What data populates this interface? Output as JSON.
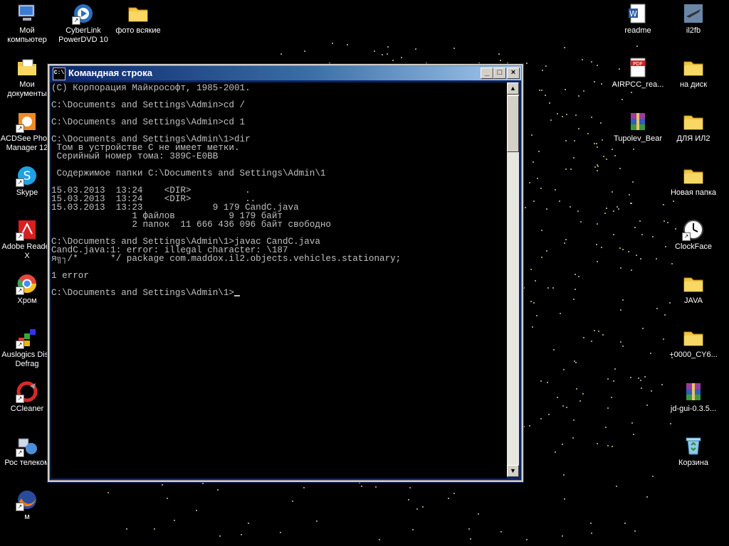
{
  "desktop": {
    "left_icons": [
      {
        "label": "Мой\nкомпьютер",
        "icon": "my-computer-icon"
      },
      {
        "label": "Мои\nдокументы",
        "icon": "my-documents-icon"
      },
      {
        "label": "ACDSee Photo\nManager 12",
        "icon": "acdsee-icon"
      },
      {
        "label": "Skype",
        "icon": "skype-icon"
      },
      {
        "label": "Adobe Reader\nX",
        "icon": "adobe-reader-icon"
      },
      {
        "label": "Хром",
        "icon": "chrome-icon"
      },
      {
        "label": "Auslogics Disk\nDefrag",
        "icon": "auslogics-icon"
      },
      {
        "label": "CCleaner",
        "icon": "ccleaner-icon"
      },
      {
        "label": "Рос телеком",
        "icon": "network-icon"
      },
      {
        "label": "м",
        "icon": "firefox-icon"
      }
    ],
    "top_icons": [
      {
        "label": "CyberLink\nPowerDVD 10",
        "icon": "powerdvd-icon"
      },
      {
        "label": "фото всякие",
        "icon": "folder-icon"
      }
    ],
    "right_col1": [
      {
        "label": "readme",
        "icon": "word-doc-icon"
      },
      {
        "label": "AIRPCC_rea...",
        "icon": "pdf-icon"
      },
      {
        "label": "Tupolev_Bear",
        "icon": "winrar-icon"
      }
    ],
    "right_col2": [
      {
        "label": "il2fb",
        "icon": "il2fb-icon"
      },
      {
        "label": "на диск",
        "icon": "folder-icon"
      },
      {
        "label": "ДЛЯ ИЛ2",
        "icon": "folder-icon"
      },
      {
        "label": "Новая папка",
        "icon": "folder-icon"
      },
      {
        "label": "ClockFace",
        "icon": "clock-icon"
      },
      {
        "label": "JAVA",
        "icon": "folder-icon"
      },
      {
        "label": "+0000_CY6...",
        "icon": "folder-icon"
      },
      {
        "label": "jd-gui-0.3.5...",
        "icon": "winrar-icon"
      },
      {
        "label": "Корзина",
        "icon": "recycle-bin-icon"
      }
    ]
  },
  "window": {
    "title": "Командная строка",
    "sys_icon_text": "C:\\",
    "minimize": "_",
    "maximize": "□",
    "close": "×"
  },
  "console": {
    "lines": [
      "(C) Корпорация Майкрософт, 1985-2001.",
      "",
      "C:\\Documents and Settings\\Admin>cd /",
      "",
      "C:\\Documents and Settings\\Admin>cd 1",
      "",
      "C:\\Documents and Settings\\Admin\\1>dir",
      " Том в устройстве C не имеет метки.",
      " Серийный номер тома: 389C-E0BB",
      "",
      " Содержимое папки C:\\Documents and Settings\\Admin\\1",
      "",
      "15.03.2013  13:24    <DIR>          .",
      "15.03.2013  13:24    <DIR>          ..",
      "15.03.2013  13:23             9 179 CandC.java",
      "               1 файлов          9 179 байт",
      "               2 папок  11 666 436 096 байт свободно",
      "",
      "C:\\Documents and Settings\\Admin\\1>javac CandC.java",
      "CandC.java:1: error: illegal character: \\187",
      "я╗┐/*      */ package com.maddox.il2.objects.vehicles.stationary;",
      "",
      "1 error",
      "",
      "C:\\Documents and Settings\\Admin\\1>"
    ]
  },
  "scrollbar": {
    "up": "▲",
    "down": "▼"
  }
}
